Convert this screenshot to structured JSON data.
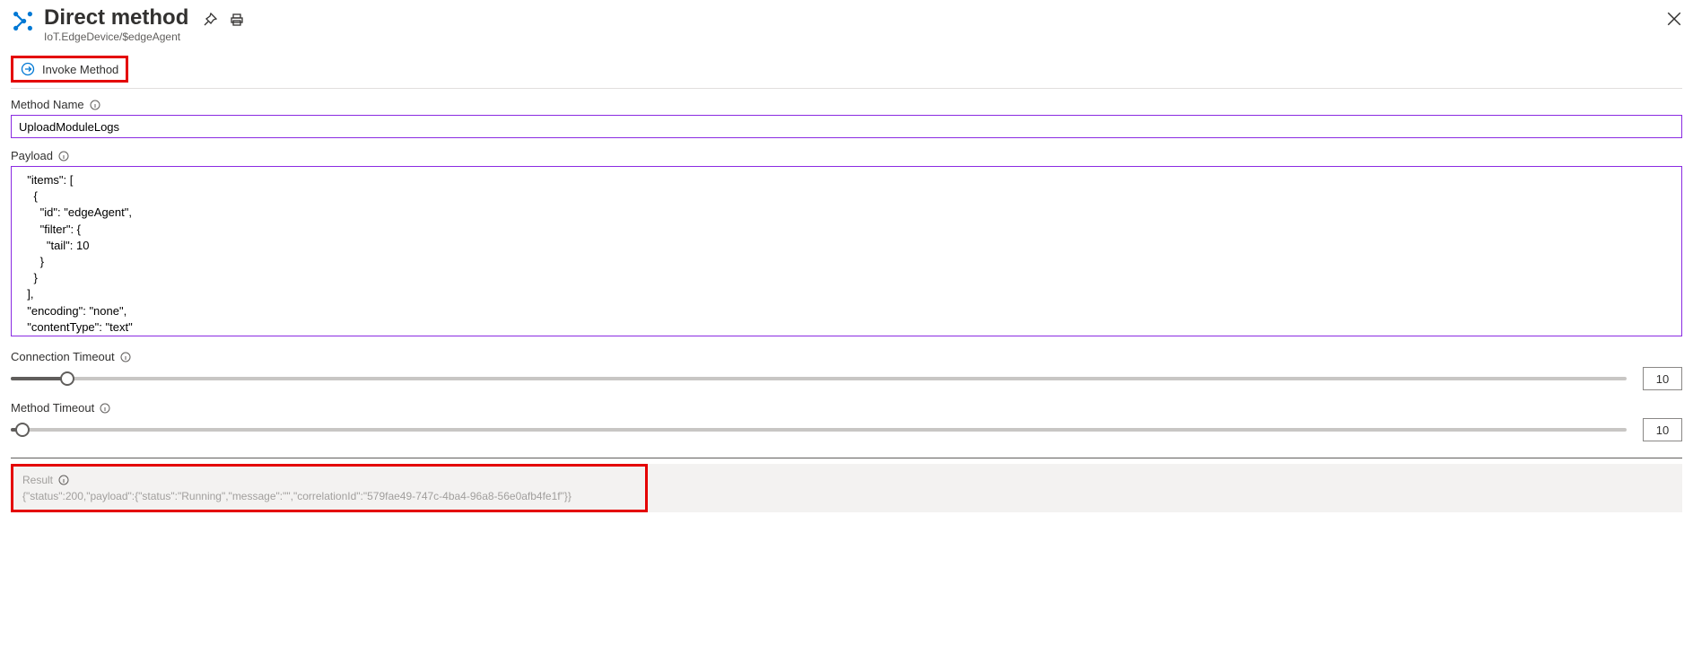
{
  "header": {
    "title": "Direct method",
    "subtitle": "IoT.EdgeDevice/$edgeAgent"
  },
  "toolbar": {
    "invoke_label": "Invoke Method"
  },
  "fields": {
    "method_name_label": "Method Name",
    "method_name_value": "UploadModuleLogs",
    "payload_label": "Payload",
    "payload_value": "  \"items\": [\n    {\n      \"id\": \"edgeAgent\",\n      \"filter\": {\n        \"tail\": 10\n      }\n    }\n  ],\n  \"encoding\": \"none\",\n  \"contentType\": \"text\"",
    "connection_timeout_label": "Connection Timeout",
    "connection_timeout_value": "10",
    "method_timeout_label": "Method Timeout",
    "method_timeout_value": "10"
  },
  "result": {
    "label": "Result",
    "value": "{\"status\":200,\"payload\":{\"status\":\"Running\",\"message\":\"\",\"correlationId\":\"579fae49-747c-4ba4-96a8-56e0afb4fe1f\"}}"
  }
}
